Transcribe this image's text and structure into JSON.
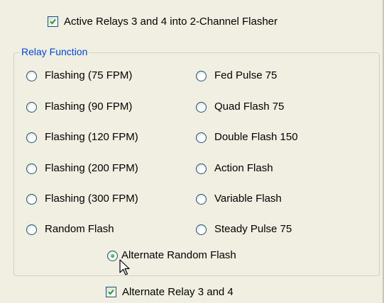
{
  "top_checkbox": {
    "label": "Active Relays 3 and 4 into 2-Channel Flasher",
    "checked": true
  },
  "relay_function": {
    "title": "Relay Function",
    "options_left": [
      "Flashing (75 FPM)",
      "Flashing (90 FPM)",
      "Flashing (120 FPM)",
      "Flashing (200 FPM)",
      "Flashing (300 FPM)",
      "Random Flash"
    ],
    "options_right": [
      "Fed Pulse 75",
      "Quad Flash 75",
      "Double Flash 150",
      "Action Flash",
      "Variable Flash",
      "Steady Pulse 75"
    ],
    "option_center": "Alternate Random Flash",
    "selected": "Alternate Random Flash"
  },
  "bottom_checkbox": {
    "label": "Alternate Relay 3 and 4",
    "checked": true
  },
  "colors": {
    "background": "#f1efe2",
    "group_title": "#0046d5",
    "check_mark": "#21a121"
  },
  "icons": {
    "cursor": "arrow-cursor-icon",
    "check": "check-icon"
  }
}
